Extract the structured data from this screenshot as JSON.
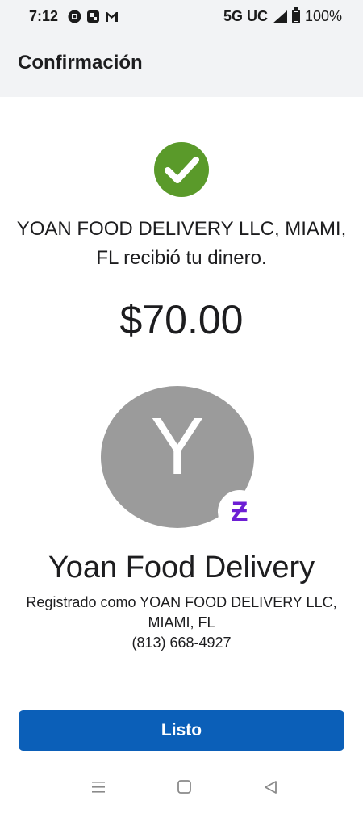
{
  "status_bar": {
    "time": "7:12",
    "network": "5G UC",
    "battery": "100%",
    "icons": [
      "chase-icon",
      "app-icon",
      "gmail-icon",
      "signal-icon",
      "battery-icon"
    ]
  },
  "header": {
    "title": "Confirmación"
  },
  "confirmation": {
    "message": "YOAN FOOD DELIVERY LLC, MIAMI, FL recibió tu dinero.",
    "amount": "$70.00"
  },
  "recipient": {
    "avatar_letter": "Y",
    "business_name": "Yoan Food Delivery",
    "registered_as": "Registrado como YOAN FOOD DELIVERY LLC, MIAMI, FL",
    "phone": "(813) 668-4927",
    "badge_symbol": "Ƶ"
  },
  "actions": {
    "done_label": "Listo"
  },
  "colors": {
    "accent": "#0b5fb8",
    "success": "#5a9a2a",
    "zelle": "#6d1ed4",
    "avatar_bg": "#9b9b9b"
  }
}
